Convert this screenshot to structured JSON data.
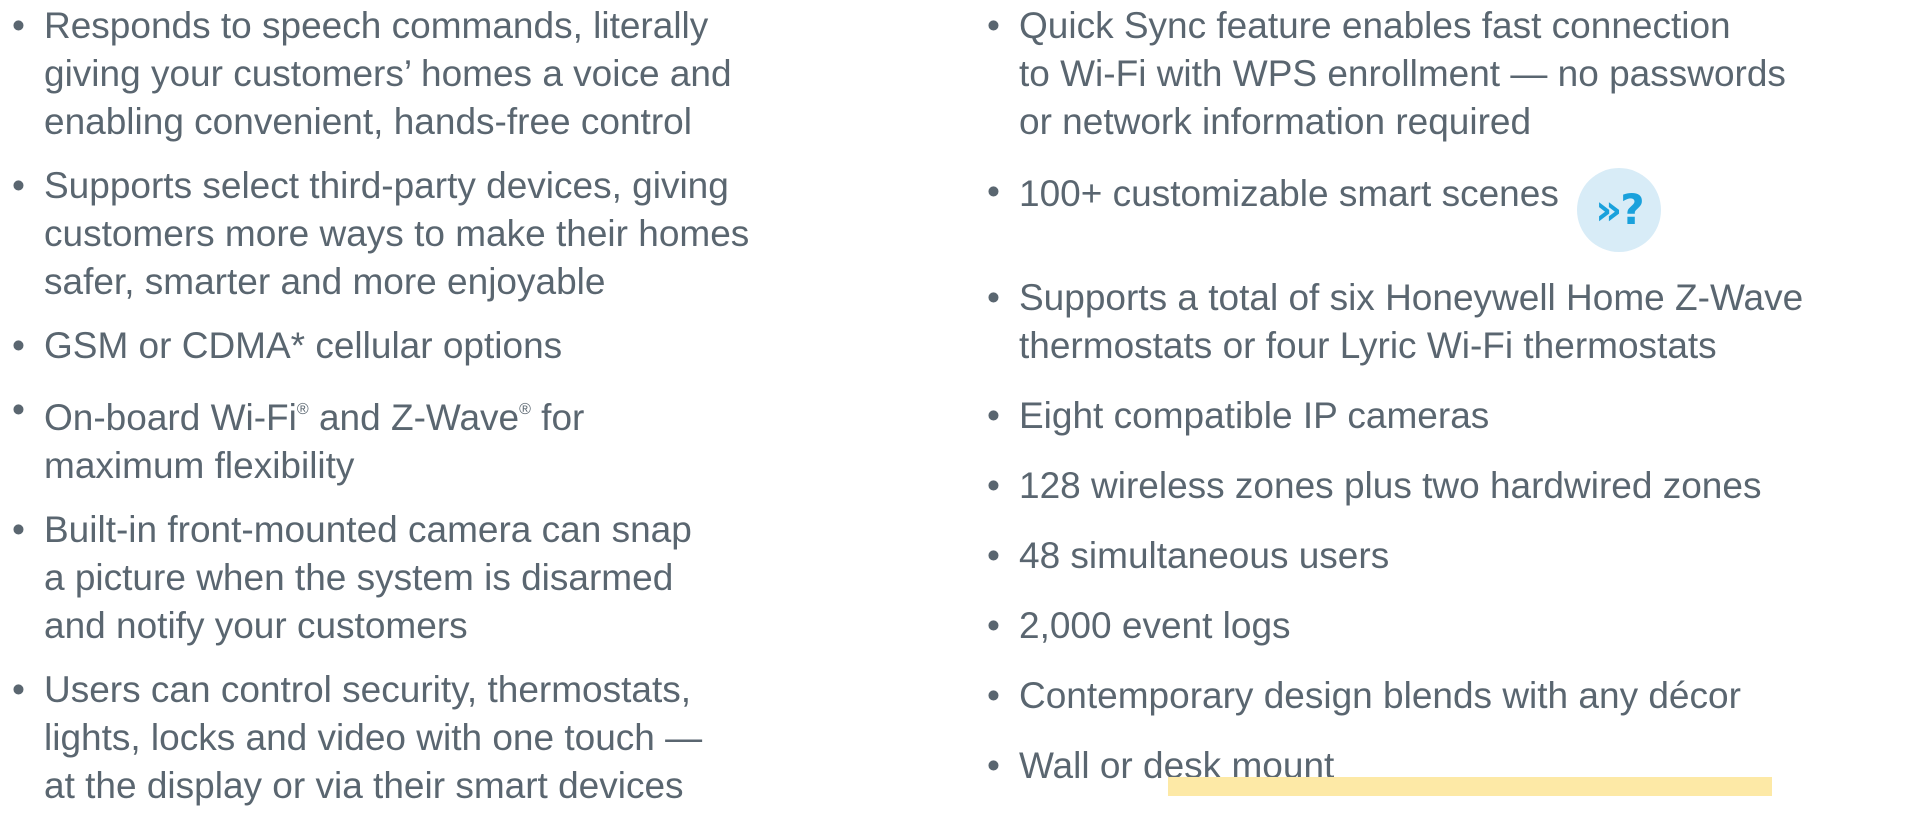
{
  "bullet": "•",
  "left_items": [
    {
      "lines": [
        "Responds to speech commands, literally",
        "giving your customers’ homes a voice and",
        "enabling convenient, hands-free control"
      ]
    },
    {
      "lines": [
        "Supports select third-party devices, giving",
        "customers more ways to make their homes",
        "safer, smarter and more enjoyable"
      ]
    },
    {
      "lines": [
        "GSM or CDMA* cellular options"
      ]
    },
    {
      "lines": [
        "On-board Wi-Fi® and Z-Wave® for",
        "maximum flexibility"
      ]
    },
    {
      "lines": [
        "Built-in front-mounted camera can snap",
        "a picture when the system is disarmed",
        "and notify your customers"
      ]
    },
    {
      "lines": [
        "Users can control security, thermostats,",
        "lights, locks and video with one touch —",
        "at the display or via their smart devices"
      ]
    }
  ],
  "right_items": [
    {
      "lines": [
        "Quick Sync feature enables fast connection",
        "to Wi-Fi with WPS enrollment — no passwords",
        "or network information required"
      ]
    },
    {
      "lines": [
        "100+ customizable smart scenes"
      ],
      "icon": "help-question-icon",
      "icon_text": "»?"
    },
    {
      "lines": [
        "Supports a total of six Honeywell Home Z-Wave",
        "thermostats or four Lyric Wi-Fi thermostats"
      ]
    },
    {
      "lines": [
        "Eight compatible IP cameras"
      ]
    },
    {
      "lines": [
        "128 wireless zones plus two hardwired zones"
      ]
    },
    {
      "lines": [
        "48 simultaneous users"
      ]
    },
    {
      "lines": [
        "2,000 event logs"
      ]
    },
    {
      "lines": [
        "Contemporary design blends with any décor"
      ]
    },
    {
      "lines": [
        "Wall or desk mount"
      ]
    }
  ],
  "colors": {
    "text": "#5a6670",
    "icon_bg": "#d8ecf7",
    "icon_fg": "#1aa1dc",
    "bar": "#fde9a6"
  }
}
